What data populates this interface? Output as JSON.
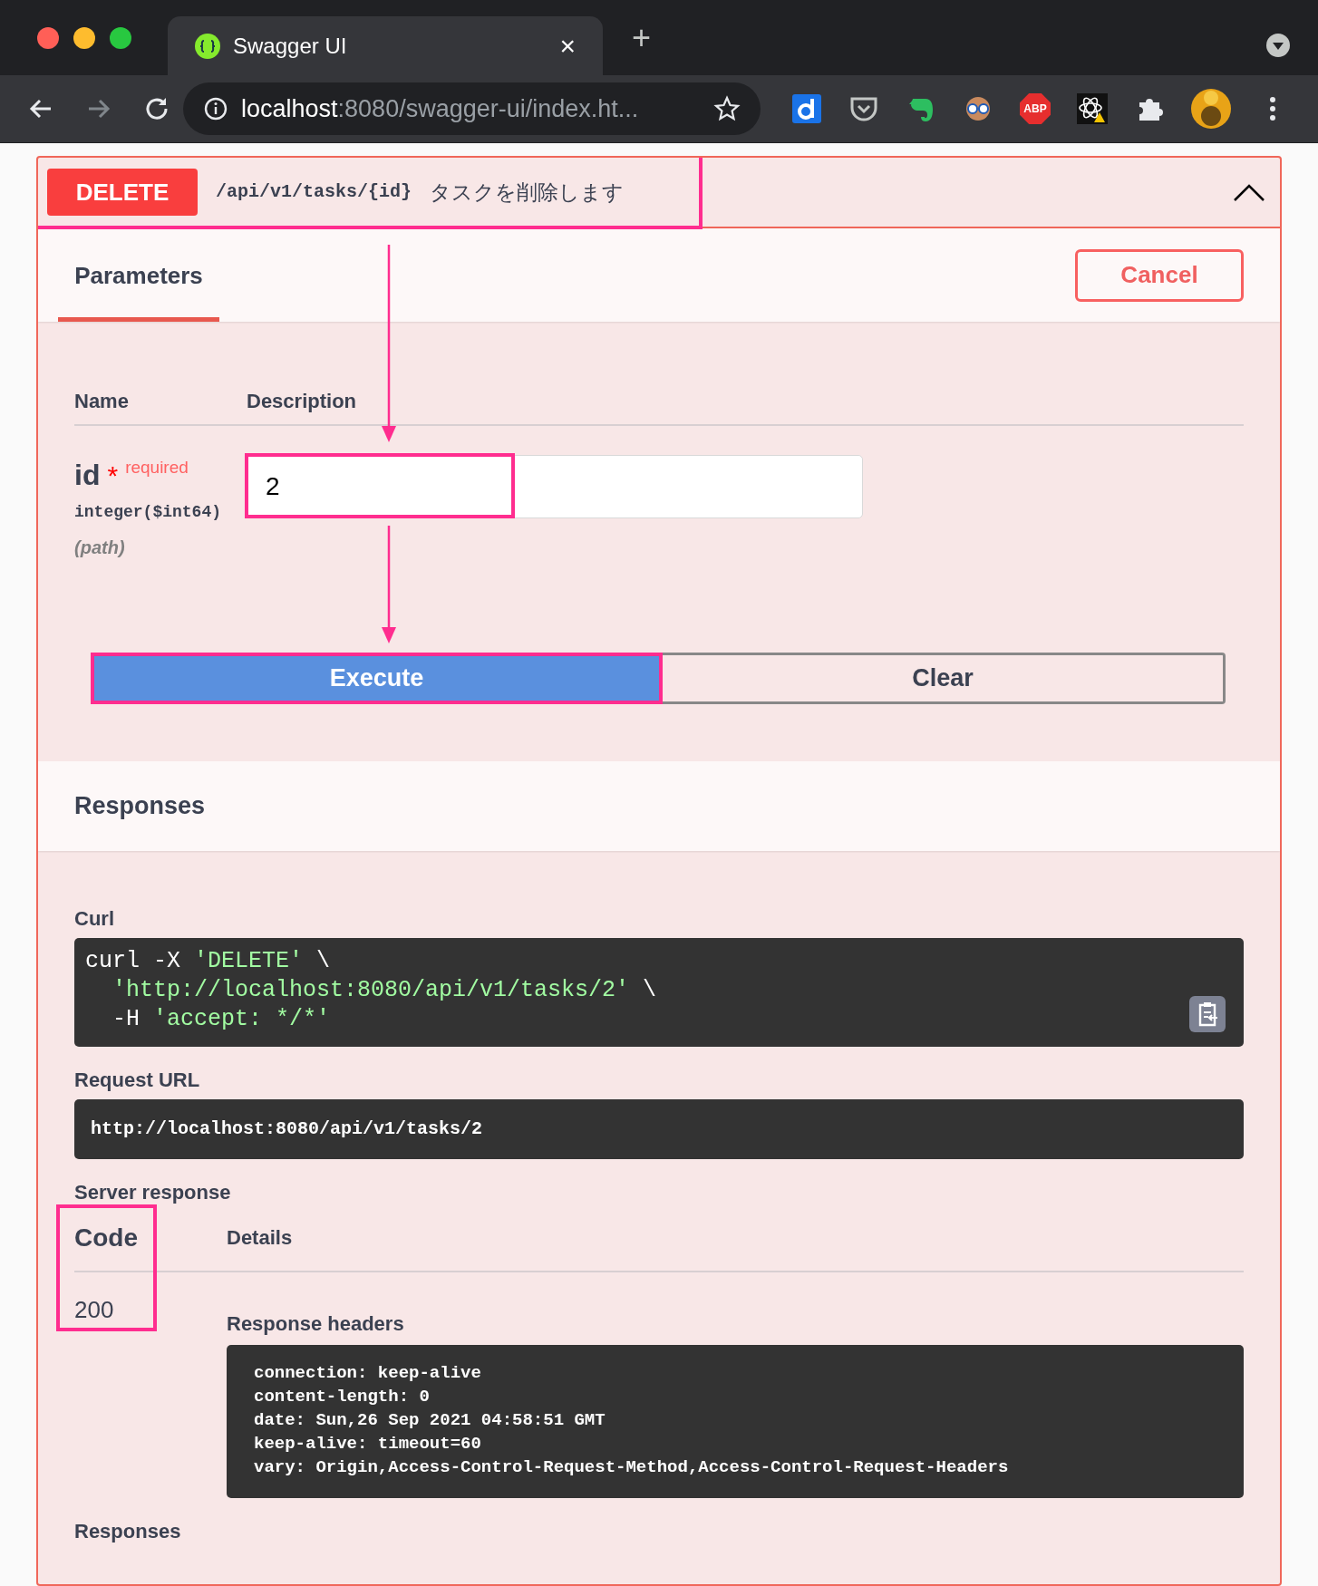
{
  "browser": {
    "tab": {
      "title": "Swagger UI",
      "close": "×",
      "selected": true
    },
    "new_tab": "+",
    "url": {
      "host": "localhost",
      "rest": ":8080/swagger-ui/index.ht..."
    },
    "abp_label": "ABP"
  },
  "operation": {
    "method": "DELETE",
    "path": "/api/v1/tasks/{id}",
    "summary": "タスクを削除します",
    "expanded": true
  },
  "params_header": {
    "tabs": [
      {
        "label": "Parameters",
        "selected": true
      }
    ],
    "cancel": "Cancel"
  },
  "parameters": {
    "columns": [
      "Name",
      "Description"
    ],
    "rows": [
      {
        "name": "id",
        "required_mark": "*",
        "required": "required",
        "type": "integer($int64)",
        "location": "(path)",
        "value": "2"
      }
    ]
  },
  "buttons": {
    "execute": "Execute",
    "clear": "Clear"
  },
  "responses_title": "Responses",
  "curl": {
    "label": "Curl",
    "lines": [
      [
        {
          "kind": "plain",
          "text": "curl -X "
        },
        {
          "kind": "string",
          "text": "'DELETE'"
        },
        {
          "kind": "plain",
          "text": " \\"
        }
      ],
      [
        {
          "kind": "string",
          "text": "'http://localhost:8080/api/v1/tasks/2'"
        },
        {
          "kind": "plain",
          "text": " \\"
        }
      ],
      [
        {
          "kind": "plain",
          "text": "-H "
        },
        {
          "kind": "string",
          "text": "'accept: */*'"
        }
      ]
    ]
  },
  "request_url": {
    "label": "Request URL",
    "value": "http://localhost:8080/api/v1/tasks/2"
  },
  "server_response": {
    "label": "Server response",
    "columns": [
      "Code",
      "Details"
    ],
    "code": "200",
    "headers_label": "Response headers",
    "headers": [
      "connection: keep-alive",
      "content-length: 0",
      "date: Sun,26 Sep 2021 04:58:51 GMT",
      "keep-alive: timeout=60",
      "vary: Origin,Access-Control-Request-Method,Access-Control-Request-Headers"
    ]
  },
  "responses_label": "Responses"
}
